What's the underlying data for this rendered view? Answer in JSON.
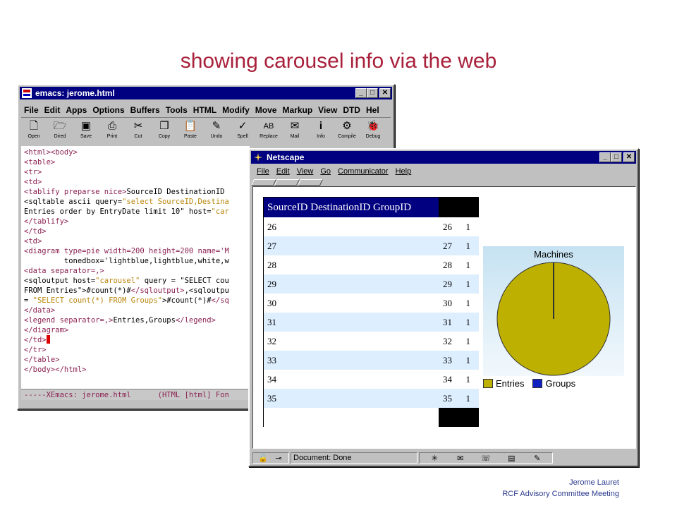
{
  "slide": {
    "title": "showing carousel info via the web",
    "author": "Jerome Lauret",
    "event": "RCF Advisory Committee Meeting"
  },
  "emacs": {
    "title": "emacs: jerome.html",
    "menu": [
      "File",
      "Edit",
      "Apps",
      "Options",
      "Buffers",
      "Tools",
      "HTML",
      "Modify",
      "Move",
      "Markup",
      "View",
      "DTD",
      "Hel"
    ],
    "toolbar": [
      {
        "label": "Open",
        "icon": "file-icon"
      },
      {
        "label": "Dired",
        "icon": "folder-icon"
      },
      {
        "label": "Save",
        "icon": "floppy-icon"
      },
      {
        "label": "Print",
        "icon": "printer-icon"
      },
      {
        "label": "Cut",
        "icon": "scissors-icon"
      },
      {
        "label": "Copy",
        "icon": "copy-icon"
      },
      {
        "label": "Paste",
        "icon": "paste-icon"
      },
      {
        "label": "Undo",
        "icon": "undo-icon"
      },
      {
        "label": "Spell",
        "icon": "spell-icon"
      },
      {
        "label": "Replace",
        "icon": "replace-icon"
      },
      {
        "label": "Mail",
        "icon": "mail-icon"
      },
      {
        "label": "Info",
        "icon": "info-icon"
      },
      {
        "label": "Compile",
        "icon": "compile-icon"
      },
      {
        "label": "Debug",
        "icon": "debug-icon"
      }
    ],
    "code": {
      "l1_tags": "<html><body>",
      "l2": "<table>",
      "l3": "<tr>",
      "l4": "<td>",
      "l5_tag": "<tablify preparse nice>",
      "l5_text": "SourceID DestinationID",
      "l6_tag": "<sqltable ascii query=",
      "l6_str": "\"select SourceID,Destina",
      "l7_text": "Entries order by EntryDate limit 10\" host=",
      "l7_str": "\"car",
      "l8": "</tablify>",
      "l9": "</td>",
      "l10": "<td>",
      "l11_tag": "<diagram type=pie width=200 height=200 name='M",
      "l12": "         tonedbox='lightblue,lightblue,white,w",
      "l13": "<data separator=,>",
      "l14_tag": "<sqloutput host=",
      "l14_str": "\"carousel\"",
      "l14_tail": " query = \"SELECT cou",
      "l15_text": "FROM Entries\">#count(*)#",
      "l15_tag": "</sqloutput>",
      "l15_tail": ",<sqloutpu",
      "l16_a": "= ",
      "l16_str": "\"SELECT count(*) FROM Groups\"",
      "l16_b": ">#count(*)#",
      "l16_tag": "</sq",
      "l17": "</data>",
      "l18_tag": "<legend separator=,>",
      "l18_text": "Entries,Groups",
      "l18_tag2": "</legend>",
      "l19": "</diagram>",
      "l20": "</td>",
      "l21": "</tr>",
      "l22": "</table>",
      "l23": "</body></html>"
    },
    "modeline": "-----XEmacs: jerome.html      (HTML [html] Fon"
  },
  "netscape": {
    "title": "Netscape",
    "menu": [
      "File",
      "Edit",
      "View",
      "Go",
      "Communicator",
      "Help"
    ],
    "status": "Document: Done",
    "table": {
      "header": "SourceID DestinationID GroupID",
      "rows": [
        {
          "src": "26",
          "dst": "26",
          "grp": "1"
        },
        {
          "src": "27",
          "dst": "27",
          "grp": "1"
        },
        {
          "src": "28",
          "dst": "28",
          "grp": "1"
        },
        {
          "src": "29",
          "dst": "29",
          "grp": "1"
        },
        {
          "src": "30",
          "dst": "30",
          "grp": "1"
        },
        {
          "src": "31",
          "dst": "31",
          "grp": "1"
        },
        {
          "src": "32",
          "dst": "32",
          "grp": "1"
        },
        {
          "src": "33",
          "dst": "33",
          "grp": "1"
        },
        {
          "src": "34",
          "dst": "34",
          "grp": "1"
        },
        {
          "src": "35",
          "dst": "35",
          "grp": "1"
        }
      ]
    }
  },
  "chart_data": {
    "type": "pie",
    "title": "Machines",
    "categories": [
      "Entries",
      "Groups"
    ],
    "values": [
      999,
      1
    ],
    "colors": [
      "#bdb000",
      "#1020c0"
    ],
    "legend": "bottom"
  }
}
